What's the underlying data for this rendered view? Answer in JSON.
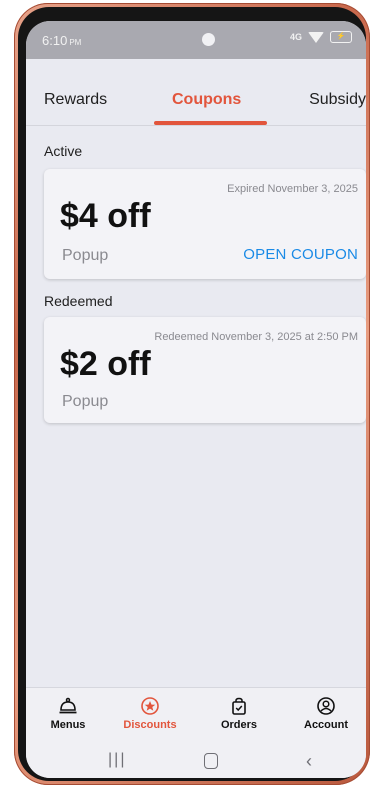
{
  "status_bar": {
    "time": "6:10",
    "ampm": "PM",
    "network": "4G",
    "battery": "⚡"
  },
  "tabs": [
    {
      "label": "Rewards"
    },
    {
      "label": "Coupons",
      "active": true
    },
    {
      "label": "Subsidy"
    }
  ],
  "sections": {
    "active": {
      "label": "Active",
      "coupon": {
        "meta": "Expired November 3, 2025",
        "amount": "$4 off",
        "source": "Popup",
        "action": "OPEN COUPON"
      }
    },
    "redeemed": {
      "label": "Redeemed",
      "coupon": {
        "meta": "Redeemed November 3, 2025 at 2:50 PM",
        "amount": "$2 off",
        "source": "Popup"
      }
    }
  },
  "bottom_nav": [
    {
      "label": "Menus",
      "icon": "cloche-icon"
    },
    {
      "label": "Discounts",
      "icon": "star-badge-icon",
      "active": true
    },
    {
      "label": "Orders",
      "icon": "shopping-bag-icon"
    },
    {
      "label": "Account",
      "icon": "account-icon"
    }
  ],
  "colors": {
    "accent": "#e2553c",
    "link": "#1a8ae6",
    "background": "#e9eaf1"
  }
}
